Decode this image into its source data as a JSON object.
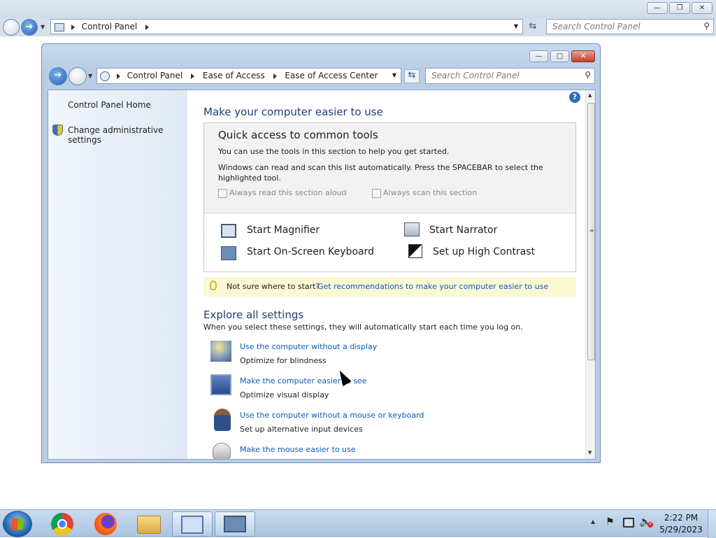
{
  "outer": {
    "address": [
      "Control Panel"
    ],
    "search_placeholder": "Search Control Panel"
  },
  "inner": {
    "address": [
      "Control Panel",
      "Ease of Access",
      "Ease of Access Center"
    ],
    "search_placeholder": "Search Control Panel"
  },
  "sidebar": {
    "home": "Control Panel Home",
    "admin": "Change administrative settings"
  },
  "main": {
    "title": "Make your computer easier to use",
    "quick": {
      "heading": "Quick access to common tools",
      "desc1": "You can use the tools in this section to help you get started.",
      "desc2": "Windows can read and scan this list automatically.  Press the SPACEBAR to select the highlighted tool.",
      "read_aloud": "Always read this section aloud",
      "scan": "Always scan this section",
      "tools": [
        "Start Magnifier",
        "Start Narrator",
        "Start On-Screen Keyboard",
        "Set up High Contrast"
      ]
    },
    "hint": {
      "prefix": "Not sure where to start?",
      "link": "Get recommendations to make your computer easier to use"
    },
    "explore": {
      "heading": "Explore all settings",
      "desc": "When you select these settings, they will automatically start each time you log on.",
      "items": [
        {
          "link": "Use the computer without a display",
          "sub": "Optimize for blindness"
        },
        {
          "link": "Make the computer easier to see",
          "sub": "Optimize visual display"
        },
        {
          "link": "Use the computer without a mouse or keyboard",
          "sub": "Set up alternative input devices"
        },
        {
          "link": "Make the mouse easier to use",
          "sub": ""
        }
      ]
    }
  },
  "clock": {
    "time": "2:22 PM",
    "date": "5/29/2023"
  },
  "colors": {
    "link": "#0b5bb5",
    "heading": "#1e3f78",
    "hint_bg": "#fbf8d4"
  }
}
